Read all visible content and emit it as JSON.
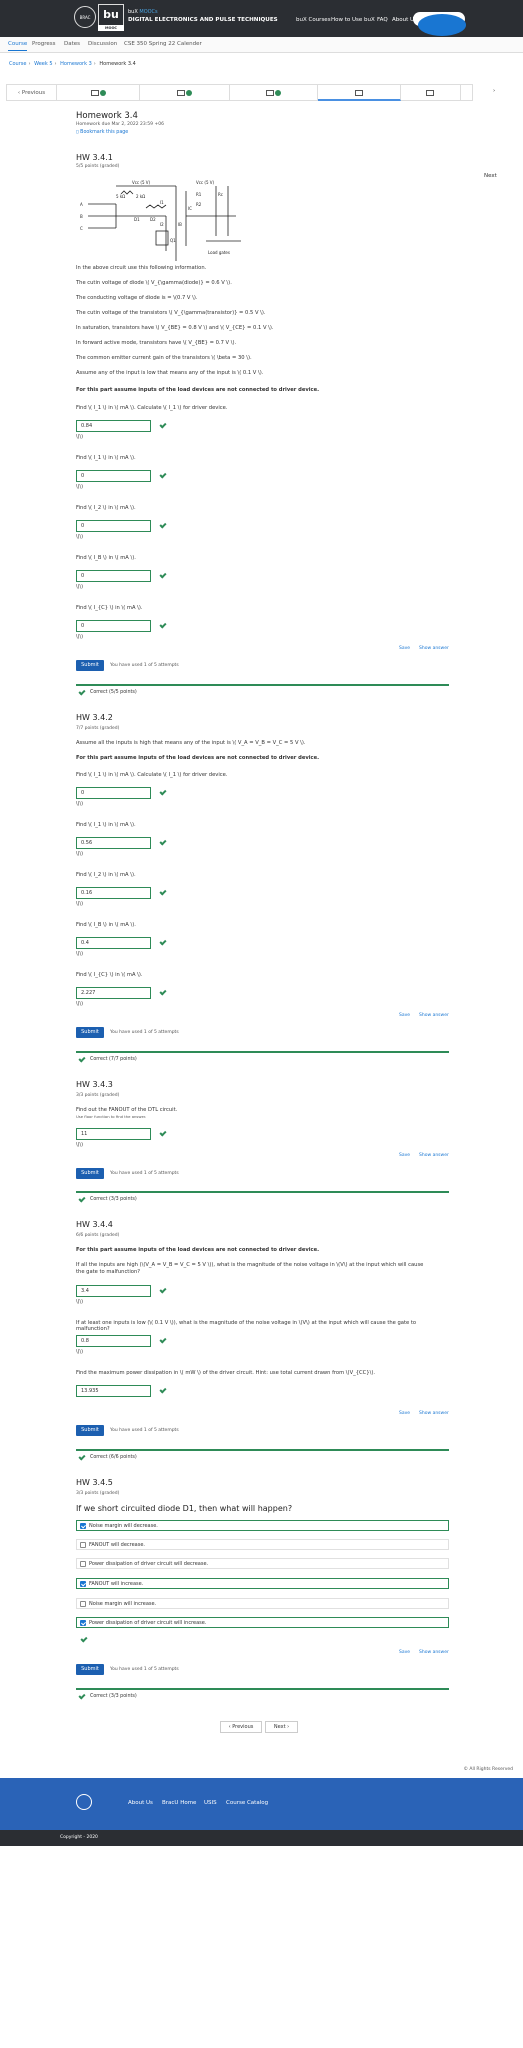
{
  "header": {
    "brand_prefix": "buX",
    "brand_suffix": "MOOCs",
    "course": "DIGITAL ELECTRONICS AND PULSE TECHNIQUES",
    "logo_circle_text": "BRAC UNIVERSITY",
    "logo_bu": "bu",
    "logo_mooc": "MOOC",
    "nav": [
      "buX Courses",
      "How to Use buX",
      "FAQ",
      "About Us"
    ]
  },
  "tabs": [
    "Course",
    "Progress",
    "Dates",
    "Discussion",
    "CSE 350 Spring 22 Calender"
  ],
  "breadcrumb": [
    "Course",
    "Week 5",
    "Homework 3",
    "Homework 3.4"
  ],
  "seqnav": {
    "prev": "Previous",
    "next": "Next"
  },
  "page": {
    "title": "Homework 3.4",
    "due": "Homework due Mar 2, 2022 23:59 +06",
    "bookmark": "Bookmark this page"
  },
  "q1": {
    "title": "HW 3.4.1",
    "points": "5/5 points (graded)",
    "intro": "In the above circuit use this following information.",
    "facts": [
      "The cutin voltage of diode \\( V_{\\gamma(diode)} = 0.6 V \\).",
      "The conducting voltage of diode is = \\(0.7 V \\).",
      "The cutin voltage of the transistors \\( V_{\\gamma(transistor)} = 0.5 V \\).",
      "In saturation, transistors have \\( V_{BE} = 0.8 V \\) and \\( V_{CE} = 0.1 V \\).",
      "In forward active mode, transistors have \\( V_{BE} = 0.7 V \\).",
      "The common emitter current gain of the transistors \\( \\beta = 30 \\).",
      "Assume any of the input is low that means any of the input is \\( 0.1 V \\)."
    ],
    "note": "For this part assume inputs of the load devices are not connected to driver device.",
    "parts": [
      {
        "prompt": "Find \\( I_1 \\) in \\( mA \\). Calculate \\( I_1 \\) for driver device.",
        "value": "0.84",
        "unit": "\\(\\)"
      },
      {
        "prompt": "Find \\( I_1 \\) in \\( mA \\).",
        "value": "0",
        "unit": "\\(\\)"
      },
      {
        "prompt": "Find \\( I_2 \\) in \\( mA \\).",
        "value": "0",
        "unit": "\\(\\)"
      },
      {
        "prompt": "Find \\( I_B \\) in \\( mA \\).",
        "value": "0",
        "unit": "\\(\\)"
      },
      {
        "prompt": "Find \\( I_{C} \\) in \\( mA \\).",
        "value": "0",
        "unit": "\\(\\)"
      }
    ],
    "attempts": "You have used 1 of 5 attempts",
    "correct": "Correct (5/5 points)"
  },
  "q2": {
    "title": "HW 3.4.2",
    "points": "7/7 points (graded)",
    "intro": "Assume all the inputs is high that means any of the input is \\( V_A = V_B = V_C = 5 V \\).",
    "note": "For this part assume inputs of the load devices are not connected to driver device.",
    "parts": [
      {
        "prompt": "Find \\( I_1 \\) in \\( mA \\). Calculate \\( I_1 \\) for driver device.",
        "value": "0",
        "unit": "\\(\\)"
      },
      {
        "prompt": "Find \\( I_1 \\) in \\( mA \\).",
        "value": "0.56",
        "unit": "\\(\\)"
      },
      {
        "prompt": "Find \\( I_2 \\) in \\( mA \\).",
        "value": "0.16",
        "unit": "\\(\\)"
      },
      {
        "prompt": "Find \\( I_B \\) in \\( mA \\).",
        "value": "0.4",
        "unit": "\\(\\)"
      },
      {
        "prompt": "Find \\( I_{C} \\) in \\( mA \\).",
        "value": "2.227",
        "unit": "\\(\\)"
      }
    ],
    "attempts": "You have used 1 of 5 attempts",
    "correct": "Correct (7/7 points)"
  },
  "q3": {
    "title": "HW 3.4.3",
    "points": "3/3 points (graded)",
    "prompt": "Find out the FANOUT of the DTL circuit.",
    "hint": "Use floor function to find the answer.",
    "value": "11",
    "unit": "\\(\\)",
    "attempts": "You have used 1 of 5 attempts",
    "correct": "Correct (3/3 points)"
  },
  "q4": {
    "title": "HW 3.4.4",
    "points": "6/6 points (graded)",
    "note": "For this part assume inputs of the load devices are not connected to driver device.",
    "parts": [
      {
        "prompt": "If all the inputs are high (\\(V_A = V_B = V_C = 5 V \\)), what is the magnitude of the noise voltage in \\(V\\) at the input which will cause the gate to malfunction?",
        "value": "3.4",
        "unit": "\\(\\)"
      },
      {
        "prompt": "If at least one inputs is low (\\( 0.1 V \\)), what is the magnitude of the noise voltage in \\(V\\) at the input which will cause the gate to malfunction?",
        "value": "0.8",
        "unit": "\\(\\)"
      },
      {
        "prompt": "Find the maximum power dissipation in \\( mW \\) of the driver circuit. Hint: use total current drawn from \\(V_{CC}\\).",
        "value": "13.935",
        "unit": ""
      }
    ],
    "attempts": "You have used 1 of 5 attempts",
    "correct": "Correct (6/6 points)"
  },
  "q5": {
    "title": "HW 3.4.5",
    "points": "3/3 points (graded)",
    "question": "If we short circuited diode D1, then what will happen?",
    "options": [
      {
        "label": "Noise margin will decrease.",
        "checked": true
      },
      {
        "label": "FANOUT will decrease.",
        "checked": false
      },
      {
        "label": "Power dissipation of driver circuit will decrease.",
        "checked": false
      },
      {
        "label": "FANOUT will increase.",
        "checked": true
      },
      {
        "label": "Noise margin will increase.",
        "checked": false
      },
      {
        "label": "Power dissipation of driver circuit will increase.",
        "checked": true
      }
    ],
    "attempts": "You have used 1 of 5 attempts",
    "correct": "Correct (3/3 points)"
  },
  "actions": {
    "save": "Save",
    "show": "Show answer",
    "submit": "Submit"
  },
  "pager": {
    "prev": "Previous",
    "next": "Next"
  },
  "footer": {
    "rights": "© All Rights Reserved",
    "links": [
      "About Us",
      "BracU Home",
      "USIS",
      "Course Catalog"
    ],
    "copyright": "Copyright - 2020"
  },
  "circuit": {
    "labels": [
      "Vcc (5 V)",
      "5 kΩ",
      "2 kΩ",
      "A",
      "B",
      "C",
      "D1",
      "D2",
      "Q1",
      "Vcc (5 V)",
      "Load gates",
      "I1",
      "I2",
      "IB",
      "IC",
      "R1",
      "R2",
      "Rc"
    ]
  }
}
